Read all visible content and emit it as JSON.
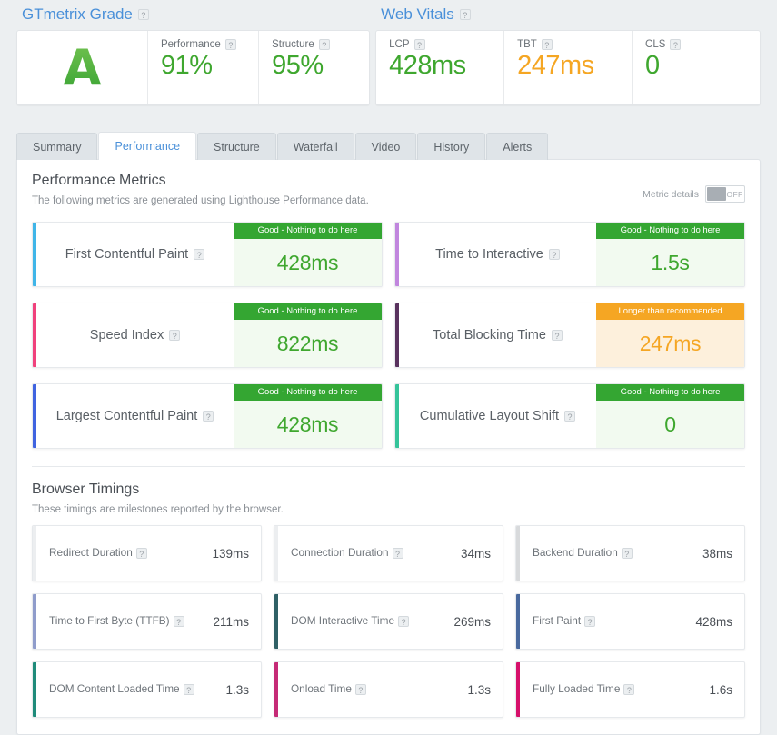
{
  "grade_section": {
    "heading": "GTmetrix Grade",
    "help_icon": "?",
    "grade": "A",
    "cells": [
      {
        "label": "Performance",
        "value": "91%"
      },
      {
        "label": "Structure",
        "value": "95%"
      }
    ]
  },
  "vitals_section": {
    "heading": "Web Vitals",
    "help_icon": "?",
    "cells": [
      {
        "label": "LCP",
        "value": "428ms",
        "tone": "green"
      },
      {
        "label": "TBT",
        "value": "247ms",
        "tone": "orange"
      },
      {
        "label": "CLS",
        "value": "0",
        "tone": "green"
      }
    ]
  },
  "tabs": [
    {
      "label": "Summary",
      "active": false
    },
    {
      "label": "Performance",
      "active": true
    },
    {
      "label": "Structure",
      "active": false
    },
    {
      "label": "Waterfall",
      "active": false
    },
    {
      "label": "Video",
      "active": false
    },
    {
      "label": "History",
      "active": false
    },
    {
      "label": "Alerts",
      "active": false
    }
  ],
  "performance_metrics": {
    "title": "Performance Metrics",
    "subtitle": "The following metrics are generated using Lighthouse Performance data.",
    "toggle_label": "Metric details",
    "toggle_state": "OFF",
    "cards": [
      {
        "name": "First Contentful Paint",
        "banner": "Good - Nothing to do here",
        "value": "428ms",
        "tone": "good",
        "bar_color": "#3fb5e8"
      },
      {
        "name": "Time to Interactive",
        "banner": "Good - Nothing to do here",
        "value": "1.5s",
        "tone": "good",
        "bar_color": "#c186de"
      },
      {
        "name": "Speed Index",
        "banner": "Good - Nothing to do here",
        "value": "822ms",
        "tone": "good",
        "bar_color": "#f0417c"
      },
      {
        "name": "Total Blocking Time",
        "banner": "Longer than recommended",
        "value": "247ms",
        "tone": "warn",
        "bar_color": "#59325e"
      },
      {
        "name": "Largest Contentful Paint",
        "banner": "Good - Nothing to do here",
        "value": "428ms",
        "tone": "good",
        "bar_color": "#3f63e0"
      },
      {
        "name": "Cumulative Layout Shift",
        "banner": "Good - Nothing to do here",
        "value": "0",
        "tone": "good",
        "bar_color": "#35c49a"
      }
    ]
  },
  "browser_timings": {
    "title": "Browser Timings",
    "subtitle": "These timings are milestones reported by the browser.",
    "cards": [
      {
        "name": "Redirect Duration",
        "value": "139ms",
        "bar_color": "#eceef0"
      },
      {
        "name": "Connection Duration",
        "value": "34ms",
        "bar_color": "#eceef0"
      },
      {
        "name": "Backend Duration",
        "value": "38ms",
        "bar_color": "#d8dadc"
      },
      {
        "name": "Time to First Byte (TTFB)",
        "value": "211ms",
        "bar_color": "#8f9ccb"
      },
      {
        "name": "DOM Interactive Time",
        "value": "269ms",
        "bar_color": "#2f6066"
      },
      {
        "name": "First Paint",
        "value": "428ms",
        "bar_color": "#49699e"
      },
      {
        "name": "DOM Content Loaded Time",
        "value": "1.3s",
        "bar_color": "#1f8b7a"
      },
      {
        "name": "Onload Time",
        "value": "1.3s",
        "bar_color": "#c52a76"
      },
      {
        "name": "Fully Loaded Time",
        "value": "1.6s",
        "bar_color": "#d6106a"
      }
    ]
  },
  "colors": {
    "accent_blue": "#4a90d9",
    "good_green": "#34a632",
    "warn_orange": "#f5a623",
    "page_bg": "#eceff1"
  }
}
